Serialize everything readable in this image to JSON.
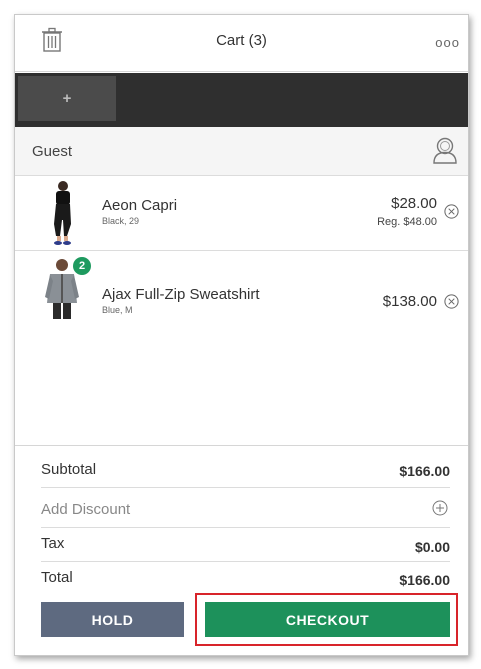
{
  "header": {
    "title": "Cart (3)",
    "more": "ooo",
    "trash_icon": "trash-icon"
  },
  "tabs": {
    "add_label": "+"
  },
  "customer": {
    "label": "Guest",
    "icon": "user-icon"
  },
  "items": [
    {
      "name": "Aeon Capri",
      "variant": "Black, 29",
      "price": "$28.00",
      "regular_price": "Reg. $48.00",
      "quantity": ""
    },
    {
      "name": "Ajax Full-Zip Sweatshirt",
      "variant": "Blue, M",
      "price": "$138.00",
      "quantity": "2"
    }
  ],
  "summary": {
    "subtotal_label": "Subtotal",
    "subtotal_value": "$166.00",
    "discount_label": "Add Discount",
    "tax_label": "Tax",
    "tax_value": "$0.00",
    "total_label": "Total",
    "total_value": "$166.00"
  },
  "actions": {
    "hold_label": "HOLD",
    "checkout_label": "CHECKOUT"
  },
  "colors": {
    "checkout": "#1d915b",
    "hold": "#5e6a80",
    "highlight": "#d8242a",
    "qty_badge": "#1e9a5f"
  }
}
